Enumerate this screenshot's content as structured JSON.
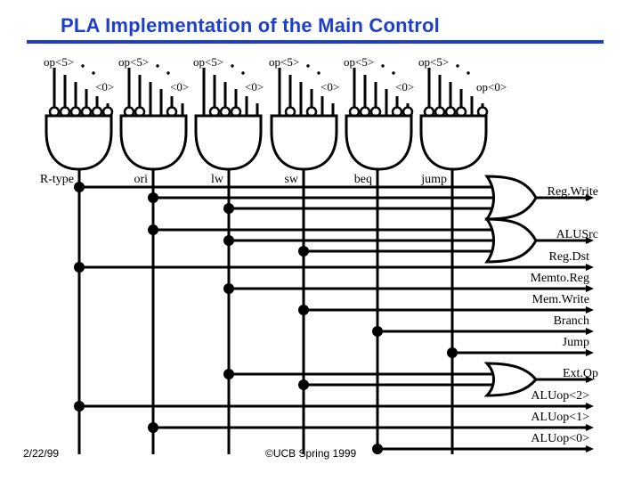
{
  "title": "PLA Implementation of the Main Control",
  "colors": {
    "title": "#1d3fcc",
    "ink": "#000000",
    "background": "#ffffff"
  },
  "input_labels": {
    "msb": "op<5>",
    "lsb": "<0>",
    "lsb_last": "op<0>"
  },
  "and_gates": [
    {
      "name": "R-type",
      "opcode": "000000",
      "inverted": [
        1,
        1,
        1,
        1,
        1,
        1
      ]
    },
    {
      "name": "ori",
      "opcode": "001101",
      "inverted": [
        1,
        1,
        0,
        0,
        1,
        0
      ]
    },
    {
      "name": "lw",
      "opcode": "100011",
      "inverted": [
        0,
        1,
        1,
        1,
        0,
        0
      ]
    },
    {
      "name": "sw",
      "opcode": "101011",
      "inverted": [
        0,
        1,
        0,
        1,
        0,
        0
      ]
    },
    {
      "name": "beq",
      "opcode": "000100",
      "inverted": [
        1,
        1,
        1,
        0,
        1,
        1
      ]
    },
    {
      "name": "jump",
      "opcode": "000010",
      "inverted": [
        1,
        1,
        1,
        1,
        0,
        1
      ]
    }
  ],
  "outputs": [
    {
      "label": "Reg.Write",
      "gate": "or",
      "sources": [
        "R-type",
        "ori",
        "lw"
      ]
    },
    {
      "label": "ALUSrc",
      "gate": "or",
      "sources": [
        "ori",
        "lw",
        "sw"
      ]
    },
    {
      "label": "Reg.Dst",
      "gate": "wire",
      "sources": [
        "R-type"
      ]
    },
    {
      "label": "Memto.Reg",
      "gate": "wire",
      "sources": [
        "lw"
      ]
    },
    {
      "label": "Mem.Write",
      "gate": "wire",
      "sources": [
        "sw"
      ]
    },
    {
      "label": "Branch",
      "gate": "wire",
      "sources": [
        "beq"
      ]
    },
    {
      "label": "Jump",
      "gate": "wire",
      "sources": [
        "jump"
      ]
    },
    {
      "label": "Ext.Op",
      "gate": "or",
      "sources": [
        "lw",
        "sw"
      ]
    },
    {
      "label": "ALUop<2>",
      "gate": "wire",
      "sources": [
        "R-type"
      ]
    },
    {
      "label": "ALUop<1>",
      "gate": "wire",
      "sources": [
        "ori"
      ]
    },
    {
      "label": "ALUop<0>",
      "gate": "wire",
      "sources": [
        "beq"
      ]
    }
  ],
  "footer": {
    "date": "2/22/99",
    "copyright": "©UCB Spring 1999"
  }
}
